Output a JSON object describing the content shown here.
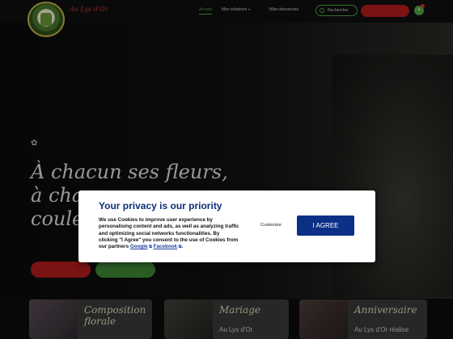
{
  "header": {
    "brand": "Au Lys d'Or",
    "nav": {
      "accueil": "Accueil",
      "mes_creations": "Mes créations",
      "villes": "Villes desservies"
    },
    "search_label": "Rechercher",
    "cart_count": ""
  },
  "hero": {
    "tagline": "À chacun ses fleurs,\nà cha\ncouleu"
  },
  "cards": [
    {
      "title": "Composition\nflorale",
      "text": ""
    },
    {
      "title": "Mariage",
      "text": "Au Lys d'Or"
    },
    {
      "title": "Anniversaire",
      "text": "Au Lys d'Or réalise"
    }
  ],
  "cookie": {
    "title": "Your privacy is our priority",
    "text_before": "We use Cookies to improve user experience by personalising content and ads, as well as analyzing traffic and optimizing social networks functionalities. By clicking \"I Agree\" you consent to the use of Cookies from our partners ",
    "link_google": "Google",
    "link_facebook": "Facebook",
    "text_after": ".",
    "customize_label": "Customize",
    "agree_label": "I AGREE"
  },
  "colors": {
    "brand_red": "#b51d1d",
    "brand_green": "#58a54b",
    "cookie_blue": "#0d3087"
  }
}
